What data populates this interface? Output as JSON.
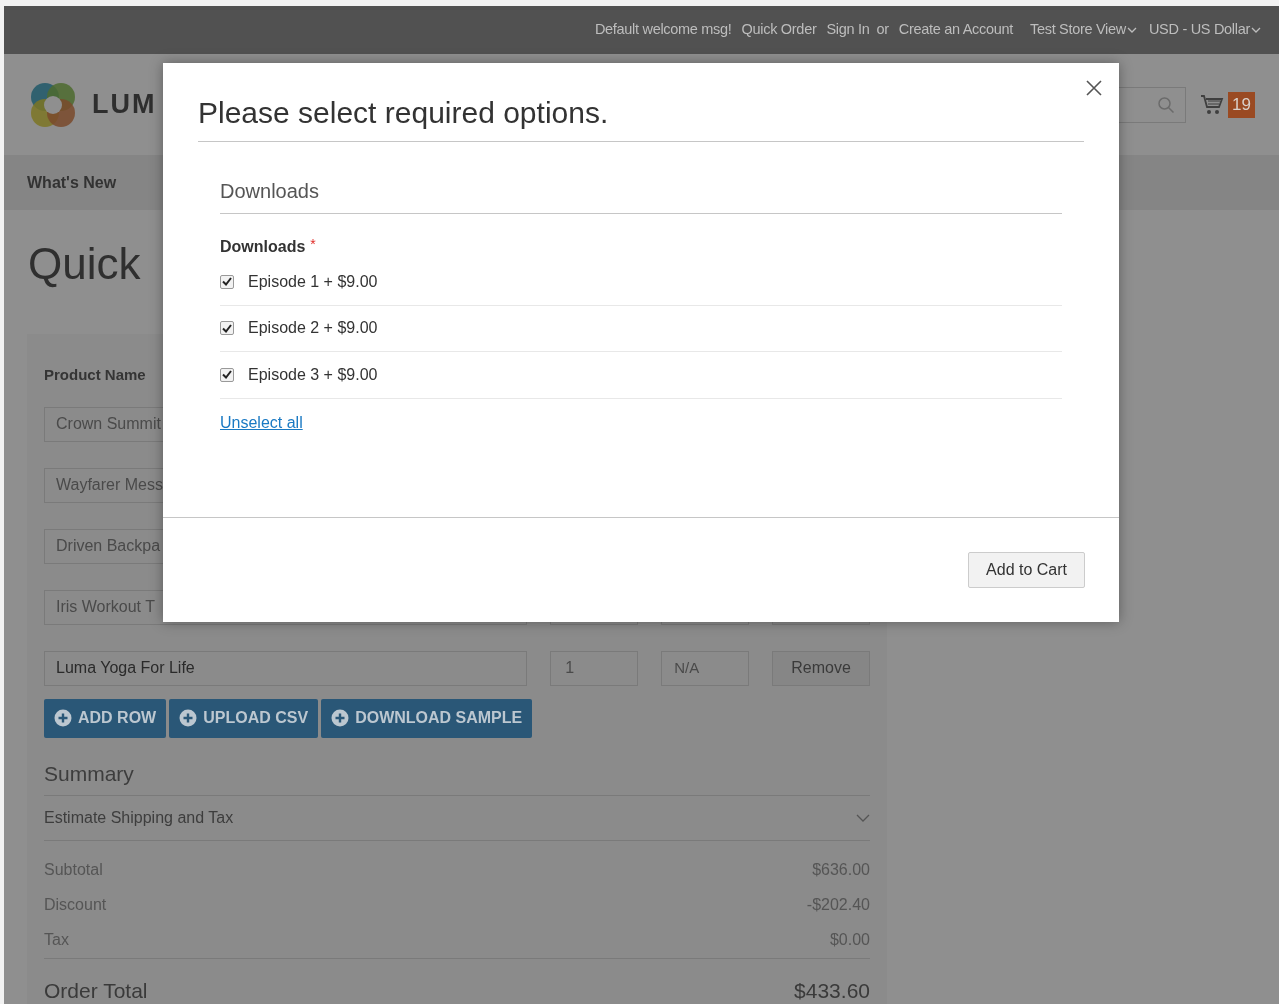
{
  "top_bar": {
    "welcome": "Default welcome msg!",
    "links": [
      "Quick Order",
      "Sign In"
    ],
    "separator": "or",
    "account_link": "Create an Account",
    "switchers": [
      "Test Store View",
      "USD - US Dollar"
    ]
  },
  "header": {
    "logo_text": "LUM",
    "cart_count": "19"
  },
  "nav": {
    "items": [
      "What's New"
    ]
  },
  "page_title": "Quick",
  "form": {
    "column": "Product Name",
    "rows": [
      {
        "name": "Crown Summit"
      },
      {
        "name": "Wayfarer Mess"
      },
      {
        "name": "Driven Backpa"
      },
      {
        "name": "Iris Workout T"
      },
      {
        "name": "Luma Yoga For Life",
        "qty": "1",
        "price": "N/A",
        "action": "Remove"
      }
    ],
    "buttons": [
      "ADD ROW",
      "UPLOAD CSV",
      "DOWNLOAD SAMPLE"
    ]
  },
  "summary": {
    "title": "Summary",
    "estimate": "Estimate Shipping and Tax",
    "expanded": false,
    "totals": [
      {
        "label": "Subtotal",
        "value": "$636.00"
      },
      {
        "label": "Discount",
        "value": "-$202.40"
      },
      {
        "label": "Tax",
        "value": "$0.00"
      }
    ],
    "order_total": {
      "label": "Order Total",
      "value": "$433.60"
    }
  },
  "modal": {
    "title": "Please select required options.",
    "section_title": "Downloads",
    "field_label": "Downloads",
    "required": true,
    "required_mark": "*",
    "options": [
      {
        "label": "Episode 1 + $9.00",
        "checked": true
      },
      {
        "label": "Episode 2 + $9.00",
        "checked": true
      },
      {
        "label": "Episode 3 + $9.00",
        "checked": true
      }
    ],
    "unselect": "Unselect all",
    "button": "Add to Cart"
  }
}
